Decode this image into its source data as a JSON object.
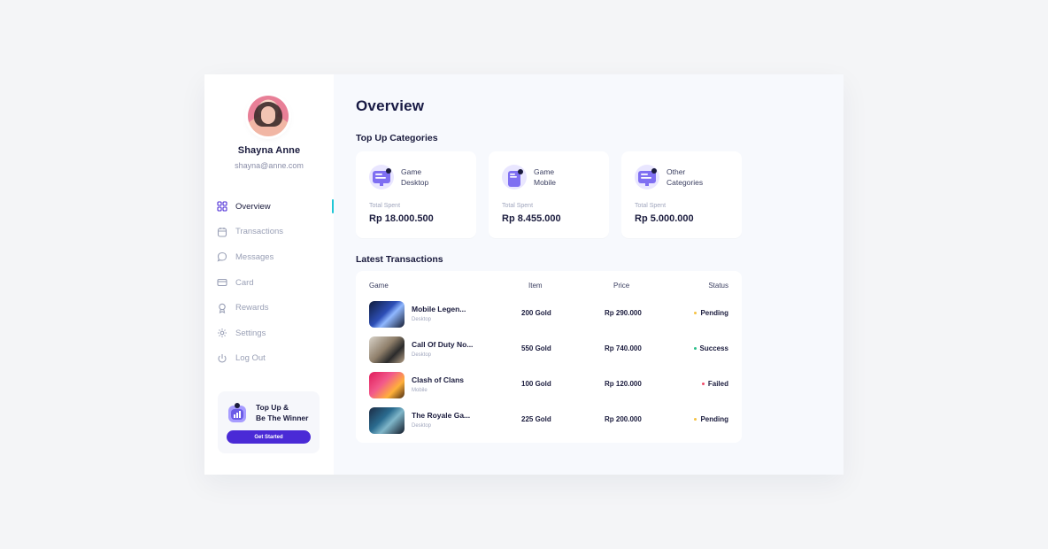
{
  "profile": {
    "name": "Shayna Anne",
    "email": "shayna@anne.com"
  },
  "nav": {
    "items": [
      {
        "label": "Overview",
        "icon": "grid-icon",
        "active": true
      },
      {
        "label": "Transactions",
        "icon": "calendar-icon",
        "active": false
      },
      {
        "label": "Messages",
        "icon": "chat-icon",
        "active": false
      },
      {
        "label": "Card",
        "icon": "card-icon",
        "active": false
      },
      {
        "label": "Rewards",
        "icon": "award-icon",
        "active": false
      },
      {
        "label": "Settings",
        "icon": "gear-icon",
        "active": false
      },
      {
        "label": "Log Out",
        "icon": "power-icon",
        "active": false
      }
    ]
  },
  "promo": {
    "line1": "Top Up &",
    "line2": "Be The Winner",
    "button": "Get Started"
  },
  "main": {
    "title": "Overview",
    "categories_title": "Top Up Categories",
    "categories": [
      {
        "line1": "Game",
        "line2": "Desktop",
        "label": "Total Spent",
        "value": "Rp 18.000.500",
        "icon": "monitor-icon"
      },
      {
        "line1": "Game",
        "line2": "Mobile",
        "label": "Total Spent",
        "value": "Rp 8.455.000",
        "icon": "mobile-icon"
      },
      {
        "line1": "Other",
        "line2": "Categories",
        "label": "Total Spent",
        "value": "Rp 5.000.000",
        "icon": "monitor-icon"
      }
    ],
    "transactions_title": "Latest Transactions",
    "columns": {
      "game": "Game",
      "item": "Item",
      "price": "Price",
      "status": "Status"
    },
    "rows": [
      {
        "game": "Mobile Legen...",
        "platform": "Desktop",
        "item": "200 Gold",
        "price": "Rp 290.000",
        "status": "Pending",
        "status_color": "#f5c242"
      },
      {
        "game": "Call Of Duty No...",
        "platform": "Desktop",
        "item": "550 Gold",
        "price": "Rp 740.000",
        "status": "Success",
        "status_color": "#2bbf8a"
      },
      {
        "game": "Clash of Clans",
        "platform": "Mobile",
        "item": "100 Gold",
        "price": "Rp 120.000",
        "status": "Failed",
        "status_color": "#ef4b6a"
      },
      {
        "game": "The Royale Ga...",
        "platform": "Desktop",
        "item": "225 Gold",
        "price": "Rp 200.000",
        "status": "Pending",
        "status_color": "#f5c242"
      }
    ]
  },
  "colors": {
    "accent": "#4a2ad6",
    "active_indicator": "#20c7d6",
    "text_dark": "#1a1b3d",
    "muted": "#9aa0b6"
  }
}
